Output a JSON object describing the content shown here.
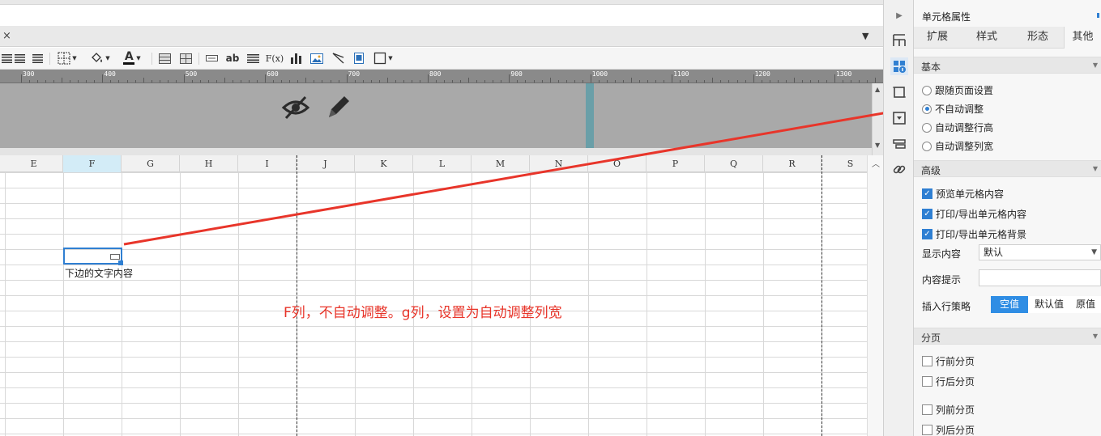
{
  "sheet": {
    "columns": [
      "E",
      "F",
      "G",
      "H",
      "I",
      "J",
      "K",
      "L",
      "M",
      "N",
      "O",
      "P",
      "Q",
      "R",
      "S"
    ],
    "active_column": "F",
    "cell_text": "下边的文字内容",
    "annotation": "F列，不自动调整。g列，设置为自动调整列宽"
  },
  "ruler": {
    "labels": [
      "300",
      "400",
      "500",
      "600",
      "700",
      "800",
      "900",
      "1000",
      "1100",
      "1200",
      "1300"
    ]
  },
  "tab": {
    "close_glyph": "×",
    "menu_glyph": "▼"
  },
  "toolbar": {
    "font_color_glyph": "A",
    "text_ab": "ab",
    "formula": "F(x)"
  },
  "panel": {
    "title": "单元格属性",
    "tabs": [
      "扩展",
      "样式",
      "形态",
      "其他"
    ],
    "active_tab": "其他",
    "basic": {
      "header": "基本",
      "options": [
        "跟随页面设置",
        "不自动调整",
        "自动调整行高",
        "自动调整列宽"
      ],
      "selected": "不自动调整"
    },
    "advanced": {
      "header": "高级",
      "checks": [
        "预览单元格内容",
        "打印/导出单元格内容",
        "打印/导出单元格背景"
      ],
      "display_label": "显示内容",
      "display_value": "默认",
      "tip_label": "内容提示",
      "tip_value": "",
      "insert_label": "插入行策略",
      "insert_options": [
        "空值",
        "默认值",
        "原值"
      ],
      "insert_selected": "空值"
    },
    "paging": {
      "header": "分页",
      "checks": [
        "行前分页",
        "行后分页",
        "列前分页",
        "列后分页"
      ]
    }
  },
  "colors": {
    "accent": "#2f7fd2",
    "annotation": "#e8352a",
    "preview_bg": "#a9a9a9",
    "marker": "#6a9fa8"
  }
}
